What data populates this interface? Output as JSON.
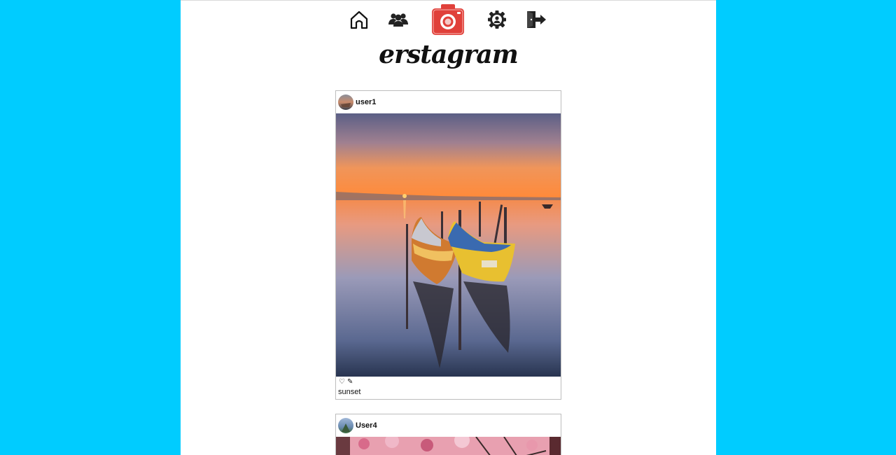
{
  "nav": {
    "items": [
      {
        "name": "home",
        "icon": "home-icon"
      },
      {
        "name": "friends",
        "icon": "users-icon"
      },
      {
        "name": "camera",
        "icon": "camera-icon",
        "color": "#e0403a"
      },
      {
        "name": "settings",
        "icon": "gear-user-icon"
      },
      {
        "name": "logout",
        "icon": "logout-icon"
      }
    ]
  },
  "brand": {
    "logo_text": "erstagram"
  },
  "posts": [
    {
      "username": "user1",
      "image": "sunset-boats-photo",
      "actions": {
        "like": "♡",
        "edit": "✎"
      },
      "caption": "sunset"
    },
    {
      "username": "User4",
      "image": "pink-blossom-photo"
    }
  ],
  "colors": {
    "background": "#00ccff",
    "panel": "#ffffff",
    "accent": "#e0403a"
  }
}
